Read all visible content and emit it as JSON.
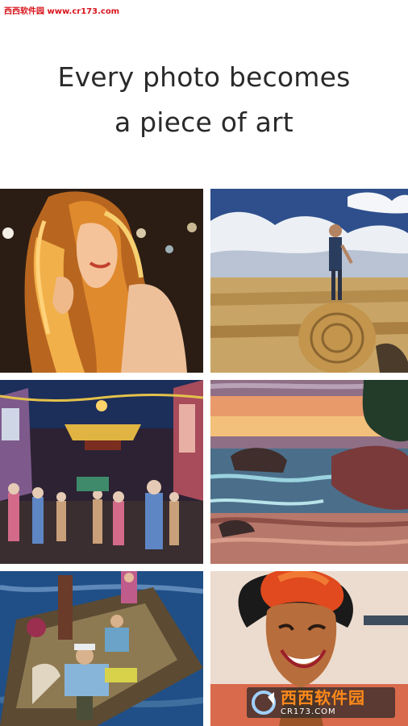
{
  "watermark": {
    "top_text": "西西软件园 www.cr173.com",
    "badge_name": "西西软件园",
    "badge_url": "CR173.COM"
  },
  "headline": {
    "line1": "Every photo becomes",
    "line2": "a piece of art"
  },
  "gallery": [
    {
      "subject": "woman-with-wavy-hair"
    },
    {
      "subject": "man-on-hay-bale"
    },
    {
      "subject": "night-market-street"
    },
    {
      "subject": "rocky-seashore-sunset"
    },
    {
      "subject": "people-on-boat"
    },
    {
      "subject": "smiling-woman-portrait"
    }
  ],
  "colors": {
    "watermark_red": "#d8141c",
    "headline_text": "#2a2a2a",
    "badge_orange": "#ff8a1a"
  }
}
